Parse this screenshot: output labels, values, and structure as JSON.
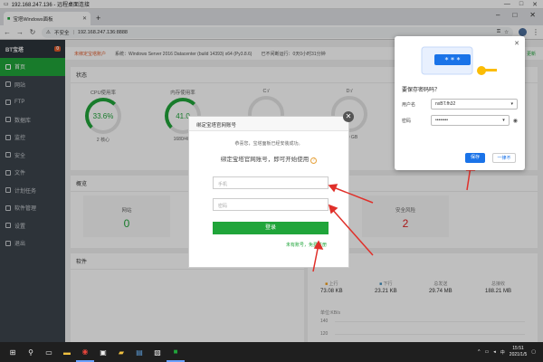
{
  "remote_title": "192.168.247.136 - 远程桌面连接",
  "browser": {
    "tab_title": "宝塔Windows面板",
    "security_label": "不安全",
    "url": "192.168.247.136:8888"
  },
  "sidebar": {
    "logo_text": "BT宝塔",
    "badge": "0",
    "items": [
      {
        "label": "首页"
      },
      {
        "label": "网站"
      },
      {
        "label": "FTP"
      },
      {
        "label": "数据库"
      },
      {
        "label": "监控"
      },
      {
        "label": "安全"
      },
      {
        "label": "文件"
      },
      {
        "label": "计划任务"
      },
      {
        "label": "软件管理"
      },
      {
        "label": "设置"
      },
      {
        "label": "退出"
      }
    ]
  },
  "infobar": {
    "warning": "未绑定宝塔账户",
    "system": "系统：Windows Server 2016 Datacenter (build 14393) x64 (Py3.8.6)",
    "uptime": "已不间断运行：0天0小时31分钟",
    "update": "更新"
  },
  "status": {
    "title": "状态",
    "gauges": [
      {
        "label": "CPU使用率",
        "value": "33.6%",
        "sub": "2 核心"
      },
      {
        "label": "内存使用率",
        "value": "41.0",
        "sub": "1680/409"
      },
      {
        "label": "C:/",
        "value": "",
        "sub": ""
      },
      {
        "label": "D:/",
        "value": "",
        "sub": "0.00 GB"
      }
    ]
  },
  "overview": {
    "title": "概览",
    "stats": [
      {
        "label": "网站",
        "value": "0",
        "color": "#20a53a"
      },
      {
        "label": "安全风险",
        "value": "2",
        "color": "#e02020"
      }
    ]
  },
  "software": {
    "title": "软件"
  },
  "traffic": {
    "items": [
      {
        "label": "上行",
        "value": "73.08 KB"
      },
      {
        "label": "下行",
        "value": "23.21 KB"
      },
      {
        "label": "总发送",
        "value": "29.74 MB"
      },
      {
        "label": "总接收",
        "value": "188.21 MB"
      }
    ],
    "unit": "单位:KB/s",
    "ticks": [
      "140",
      "120"
    ]
  },
  "modal": {
    "title": "绑定宝塔官网账号",
    "msg1": "恭喜您，宝塔面板已经安装成功。",
    "msg2": "绑定宝塔官网账号，即可开始使用",
    "phone_placeholder": "手机",
    "password_placeholder": "密码",
    "login_label": "登录",
    "register_link": "未有账号，免费注册"
  },
  "password_popup": {
    "title": "要保存密码吗？",
    "username_label": "用户名",
    "username_value": "nxBT.fh32",
    "password_label": "密码",
    "password_mask": "••••••••",
    "save_label": "保存",
    "never_label": "一律不"
  },
  "taskbar": {
    "time": "15:51",
    "date": "2021/1/5",
    "lang": "中"
  }
}
